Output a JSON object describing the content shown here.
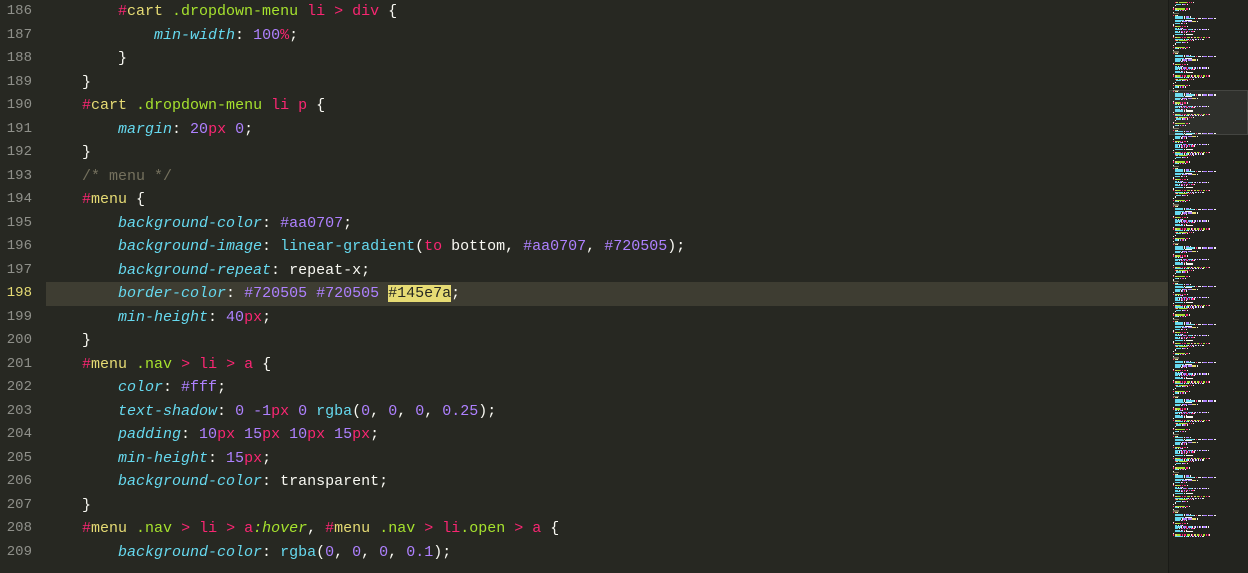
{
  "editor": {
    "startLine": 186,
    "activeLine": 198,
    "highlightToken": "#145e7a",
    "lines": [
      {
        "n": 186,
        "indent": 2,
        "segs": [
          {
            "t": "#",
            "c": "c-hash"
          },
          {
            "t": "cart ",
            "c": "c-id"
          },
          {
            "t": ".dropdown-menu ",
            "c": "c-cls"
          },
          {
            "t": "li ",
            "c": "c-tag"
          },
          {
            "t": "> ",
            "c": "c-combin"
          },
          {
            "t": "div ",
            "c": "c-tag"
          },
          {
            "t": "{",
            "c": "c-punc"
          }
        ]
      },
      {
        "n": 187,
        "indent": 3,
        "segs": [
          {
            "t": "min-width",
            "c": "c-prop"
          },
          {
            "t": ": ",
            "c": "c-punc"
          },
          {
            "t": "100",
            "c": "c-num"
          },
          {
            "t": "%",
            "c": "c-unit"
          },
          {
            "t": ";",
            "c": "c-punc"
          }
        ]
      },
      {
        "n": 188,
        "indent": 2,
        "segs": [
          {
            "t": "}",
            "c": "c-punc"
          }
        ]
      },
      {
        "n": 189,
        "indent": 1,
        "segs": [
          {
            "t": "}",
            "c": "c-punc"
          }
        ]
      },
      {
        "n": 190,
        "indent": 1,
        "segs": [
          {
            "t": "#",
            "c": "c-hash"
          },
          {
            "t": "cart ",
            "c": "c-id"
          },
          {
            "t": ".dropdown-menu ",
            "c": "c-cls"
          },
          {
            "t": "li ",
            "c": "c-tag"
          },
          {
            "t": "p ",
            "c": "c-tag"
          },
          {
            "t": "{",
            "c": "c-punc"
          }
        ]
      },
      {
        "n": 191,
        "indent": 2,
        "segs": [
          {
            "t": "margin",
            "c": "c-prop"
          },
          {
            "t": ": ",
            "c": "c-punc"
          },
          {
            "t": "20",
            "c": "c-num"
          },
          {
            "t": "px ",
            "c": "c-unit"
          },
          {
            "t": "0",
            "c": "c-num"
          },
          {
            "t": ";",
            "c": "c-punc"
          }
        ]
      },
      {
        "n": 192,
        "indent": 1,
        "segs": [
          {
            "t": "}",
            "c": "c-punc"
          }
        ]
      },
      {
        "n": 193,
        "indent": 1,
        "segs": [
          {
            "t": "/* menu */",
            "c": "c-comm"
          }
        ]
      },
      {
        "n": 194,
        "indent": 1,
        "segs": [
          {
            "t": "#",
            "c": "c-hash"
          },
          {
            "t": "menu ",
            "c": "c-id"
          },
          {
            "t": "{",
            "c": "c-punc"
          }
        ]
      },
      {
        "n": 195,
        "indent": 2,
        "segs": [
          {
            "t": "background-color",
            "c": "c-prop"
          },
          {
            "t": ": ",
            "c": "c-punc"
          },
          {
            "t": "#aa0707",
            "c": "c-const"
          },
          {
            "t": ";",
            "c": "c-punc"
          }
        ]
      },
      {
        "n": 196,
        "indent": 2,
        "segs": [
          {
            "t": "background-image",
            "c": "c-prop"
          },
          {
            "t": ": ",
            "c": "c-punc"
          },
          {
            "t": "linear-gradient",
            "c": "c-func"
          },
          {
            "t": "(",
            "c": "c-punc"
          },
          {
            "t": "to ",
            "c": "c-kw"
          },
          {
            "t": "bottom",
            "c": "c-plain"
          },
          {
            "t": ", ",
            "c": "c-punc"
          },
          {
            "t": "#aa0707",
            "c": "c-const"
          },
          {
            "t": ", ",
            "c": "c-punc"
          },
          {
            "t": "#720505",
            "c": "c-const"
          },
          {
            "t": ")",
            "c": "c-punc"
          },
          {
            "t": ";",
            "c": "c-punc"
          }
        ]
      },
      {
        "n": 197,
        "indent": 2,
        "segs": [
          {
            "t": "background-repeat",
            "c": "c-prop"
          },
          {
            "t": ": ",
            "c": "c-punc"
          },
          {
            "t": "repeat-x",
            "c": "c-plain"
          },
          {
            "t": ";",
            "c": "c-punc"
          }
        ]
      },
      {
        "n": 198,
        "indent": 2,
        "active": true,
        "segs": [
          {
            "t": "border-color",
            "c": "c-prop"
          },
          {
            "t": ": ",
            "c": "c-punc"
          },
          {
            "t": "#720505 ",
            "c": "c-const"
          },
          {
            "t": "#720505 ",
            "c": "c-const"
          },
          {
            "t": "#145e7a",
            "c": "highlight"
          },
          {
            "t": ";",
            "c": "c-punc"
          }
        ]
      },
      {
        "n": 199,
        "indent": 2,
        "segs": [
          {
            "t": "min-height",
            "c": "c-prop"
          },
          {
            "t": ": ",
            "c": "c-punc"
          },
          {
            "t": "40",
            "c": "c-num"
          },
          {
            "t": "px",
            "c": "c-unit"
          },
          {
            "t": ";",
            "c": "c-punc"
          }
        ]
      },
      {
        "n": 200,
        "indent": 1,
        "segs": [
          {
            "t": "}",
            "c": "c-punc"
          }
        ]
      },
      {
        "n": 201,
        "indent": 1,
        "segs": [
          {
            "t": "#",
            "c": "c-hash"
          },
          {
            "t": "menu ",
            "c": "c-id"
          },
          {
            "t": ".nav ",
            "c": "c-cls"
          },
          {
            "t": "> ",
            "c": "c-combin"
          },
          {
            "t": "li ",
            "c": "c-tag"
          },
          {
            "t": "> ",
            "c": "c-combin"
          },
          {
            "t": "a ",
            "c": "c-tag"
          },
          {
            "t": "{",
            "c": "c-punc"
          }
        ]
      },
      {
        "n": 202,
        "indent": 2,
        "segs": [
          {
            "t": "color",
            "c": "c-prop"
          },
          {
            "t": ": ",
            "c": "c-punc"
          },
          {
            "t": "#fff",
            "c": "c-const"
          },
          {
            "t": ";",
            "c": "c-punc"
          }
        ]
      },
      {
        "n": 203,
        "indent": 2,
        "segs": [
          {
            "t": "text-shadow",
            "c": "c-prop"
          },
          {
            "t": ": ",
            "c": "c-punc"
          },
          {
            "t": "0 ",
            "c": "c-num"
          },
          {
            "t": "-1",
            "c": "c-num"
          },
          {
            "t": "px ",
            "c": "c-unit"
          },
          {
            "t": "0 ",
            "c": "c-num"
          },
          {
            "t": "rgba",
            "c": "c-func"
          },
          {
            "t": "(",
            "c": "c-punc"
          },
          {
            "t": "0",
            "c": "c-num"
          },
          {
            "t": ", ",
            "c": "c-punc"
          },
          {
            "t": "0",
            "c": "c-num"
          },
          {
            "t": ", ",
            "c": "c-punc"
          },
          {
            "t": "0",
            "c": "c-num"
          },
          {
            "t": ", ",
            "c": "c-punc"
          },
          {
            "t": "0.25",
            "c": "c-num"
          },
          {
            "t": ")",
            "c": "c-punc"
          },
          {
            "t": ";",
            "c": "c-punc"
          }
        ]
      },
      {
        "n": 204,
        "indent": 2,
        "segs": [
          {
            "t": "padding",
            "c": "c-prop"
          },
          {
            "t": ": ",
            "c": "c-punc"
          },
          {
            "t": "10",
            "c": "c-num"
          },
          {
            "t": "px ",
            "c": "c-unit"
          },
          {
            "t": "15",
            "c": "c-num"
          },
          {
            "t": "px ",
            "c": "c-unit"
          },
          {
            "t": "10",
            "c": "c-num"
          },
          {
            "t": "px ",
            "c": "c-unit"
          },
          {
            "t": "15",
            "c": "c-num"
          },
          {
            "t": "px",
            "c": "c-unit"
          },
          {
            "t": ";",
            "c": "c-punc"
          }
        ]
      },
      {
        "n": 205,
        "indent": 2,
        "segs": [
          {
            "t": "min-height",
            "c": "c-prop"
          },
          {
            "t": ": ",
            "c": "c-punc"
          },
          {
            "t": "15",
            "c": "c-num"
          },
          {
            "t": "px",
            "c": "c-unit"
          },
          {
            "t": ";",
            "c": "c-punc"
          }
        ]
      },
      {
        "n": 206,
        "indent": 2,
        "segs": [
          {
            "t": "background-color",
            "c": "c-prop"
          },
          {
            "t": ": ",
            "c": "c-punc"
          },
          {
            "t": "transparent",
            "c": "c-plain"
          },
          {
            "t": ";",
            "c": "c-punc"
          }
        ]
      },
      {
        "n": 207,
        "indent": 1,
        "segs": [
          {
            "t": "}",
            "c": "c-punc"
          }
        ]
      },
      {
        "n": 208,
        "indent": 1,
        "segs": [
          {
            "t": "#",
            "c": "c-hash"
          },
          {
            "t": "menu ",
            "c": "c-id"
          },
          {
            "t": ".nav ",
            "c": "c-cls"
          },
          {
            "t": "> ",
            "c": "c-combin"
          },
          {
            "t": "li ",
            "c": "c-tag"
          },
          {
            "t": "> ",
            "c": "c-combin"
          },
          {
            "t": "a",
            "c": "c-tag"
          },
          {
            "t": ":hover",
            "c": "c-pkw"
          },
          {
            "t": ", ",
            "c": "c-punc"
          },
          {
            "t": "#",
            "c": "c-hash"
          },
          {
            "t": "menu ",
            "c": "c-id"
          },
          {
            "t": ".nav ",
            "c": "c-cls"
          },
          {
            "t": "> ",
            "c": "c-combin"
          },
          {
            "t": "li",
            "c": "c-tag"
          },
          {
            "t": ".open ",
            "c": "c-cls"
          },
          {
            "t": "> ",
            "c": "c-combin"
          },
          {
            "t": "a ",
            "c": "c-tag"
          },
          {
            "t": "{",
            "c": "c-punc"
          }
        ]
      },
      {
        "n": 209,
        "indent": 2,
        "segs": [
          {
            "t": "background-color",
            "c": "c-prop"
          },
          {
            "t": ": ",
            "c": "c-punc"
          },
          {
            "t": "rgba",
            "c": "c-func"
          },
          {
            "t": "(",
            "c": "c-punc"
          },
          {
            "t": "0",
            "c": "c-num"
          },
          {
            "t": ", ",
            "c": "c-punc"
          },
          {
            "t": "0",
            "c": "c-num"
          },
          {
            "t": ", ",
            "c": "c-punc"
          },
          {
            "t": "0",
            "c": "c-num"
          },
          {
            "t": ", ",
            "c": "c-punc"
          },
          {
            "t": "0.1",
            "c": "c-num"
          },
          {
            "t": ")",
            "c": "c-punc"
          },
          {
            "t": ";",
            "c": "c-punc"
          }
        ]
      }
    ]
  },
  "minimap": {
    "viewportTop": 90
  }
}
